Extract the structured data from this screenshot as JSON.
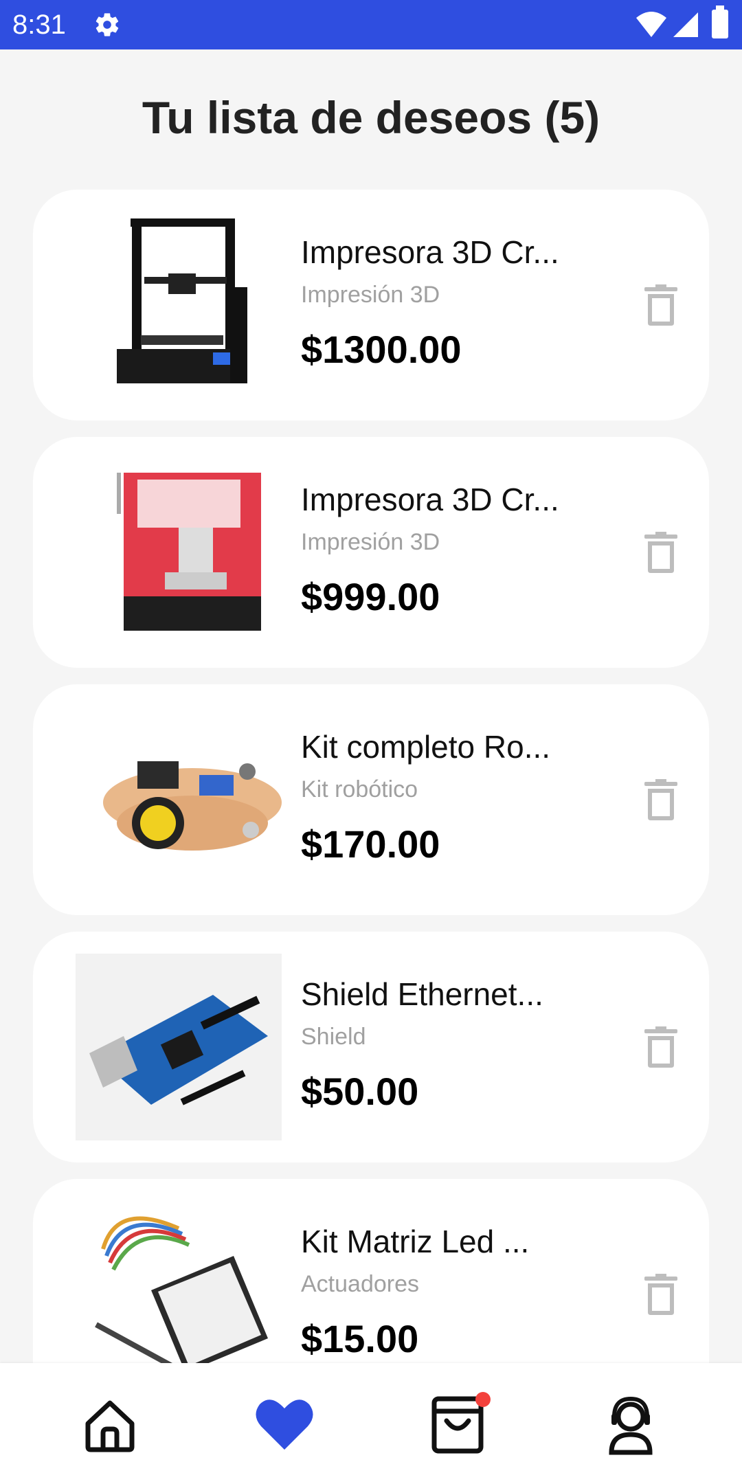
{
  "status_bar": {
    "time": "8:31",
    "icons": [
      "gear-icon",
      "wifi-icon",
      "signal-icon",
      "battery-icon"
    ],
    "background": "#2f4ee0"
  },
  "header": {
    "title": "Tu lista de deseos (5)"
  },
  "wishlist": {
    "items": [
      {
        "name": "Impresora 3D Cr...",
        "category": "Impresión 3D",
        "price": "$1300.00",
        "image": "3d-printer-black-image"
      },
      {
        "name": "Impresora 3D Cr...",
        "category": "Impresión 3D",
        "price": "$999.00",
        "image": "3d-printer-red-image"
      },
      {
        "name": "Kit completo Ro...",
        "category": "Kit robótico",
        "price": "$170.00",
        "image": "robot-car-kit-image"
      },
      {
        "name": "Shield Ethernet...",
        "category": "Shield",
        "price": "$50.00",
        "image": "ethernet-shield-image"
      },
      {
        "name": "Kit Matriz Led ...",
        "category": "Actuadores",
        "price": "$15.00",
        "image": "led-matrix-kit-image"
      }
    ]
  },
  "bottom_nav": {
    "items": [
      "home-icon",
      "heart-icon",
      "cart-icon",
      "support-icon"
    ],
    "active_color": "#2f4ee0",
    "badge_color": "#f3413c"
  }
}
